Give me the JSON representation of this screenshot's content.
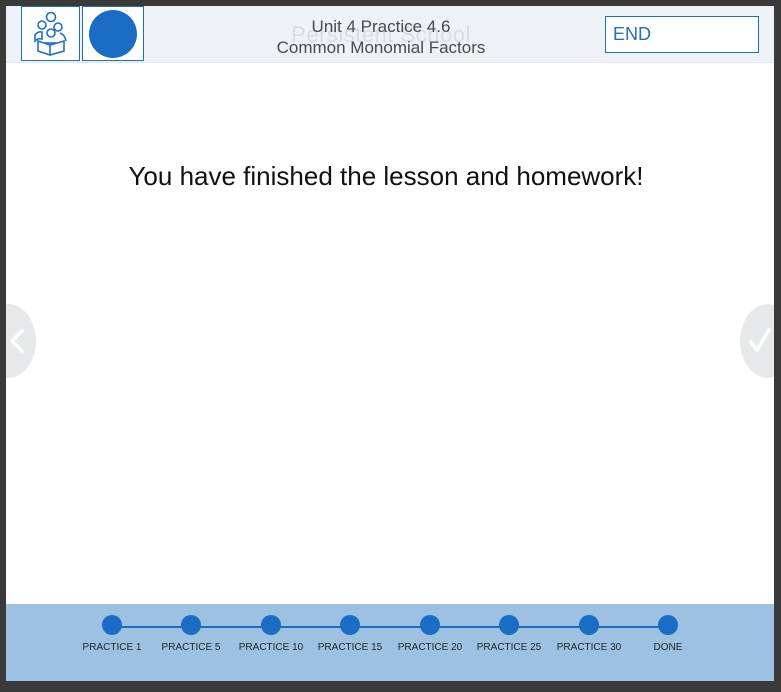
{
  "header": {
    "title_line1": "Unit 4 Practice 4.6",
    "title_line2": "Common Monomial Factors",
    "watermark": "Persistent School",
    "end_label": "END"
  },
  "main": {
    "message": "You have finished the lesson and homework!"
  },
  "nav": {
    "prev_icon": "chevron-left-icon",
    "next_icon": "checkmark-icon"
  },
  "progress": {
    "steps": [
      {
        "label": "PRACTICE 1"
      },
      {
        "label": "PRACTICE 5"
      },
      {
        "label": "PRACTICE 10"
      },
      {
        "label": "PRACTICE 15"
      },
      {
        "label": "PRACTICE 20"
      },
      {
        "label": "PRACTICE 25"
      },
      {
        "label": "PRACTICE 30"
      },
      {
        "label": "DONE"
      }
    ]
  },
  "colors": {
    "accent": "#1a6cc4",
    "footer": "#9dc1e0",
    "header": "#eef1f5"
  }
}
